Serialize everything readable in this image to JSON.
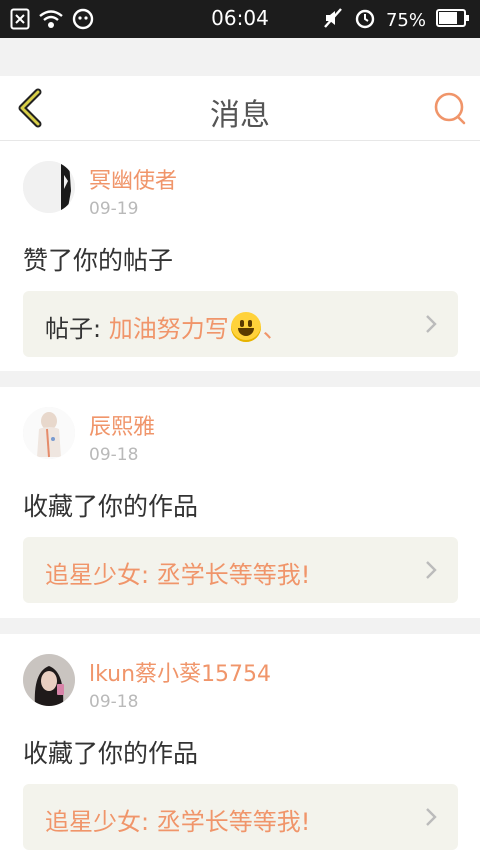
{
  "status_bar": {
    "time": "06:04",
    "battery_percent": "75%",
    "battery_level": 0.75
  },
  "header": {
    "title": "消息"
  },
  "colors": {
    "accent": "#f0956a",
    "post_bg": "#f3f3ec"
  },
  "notifications": [
    {
      "username": "冥幽使者",
      "date": "09-19",
      "action": "赞了你的帖子",
      "post_prefix": "帖子:",
      "post_title": "加油努力写",
      "post_suffix": "、",
      "post_emoji": "smiley-emoji"
    },
    {
      "username": "辰熙雅",
      "date": "09-18",
      "action": "收藏了你的作品",
      "post_title": "追星少女: 丞学长等等我!"
    },
    {
      "username": "lkun蔡小葵15754",
      "date": "09-18",
      "action": "收藏了你的作品",
      "post_title": "追星少女: 丞学长等等我!"
    }
  ]
}
